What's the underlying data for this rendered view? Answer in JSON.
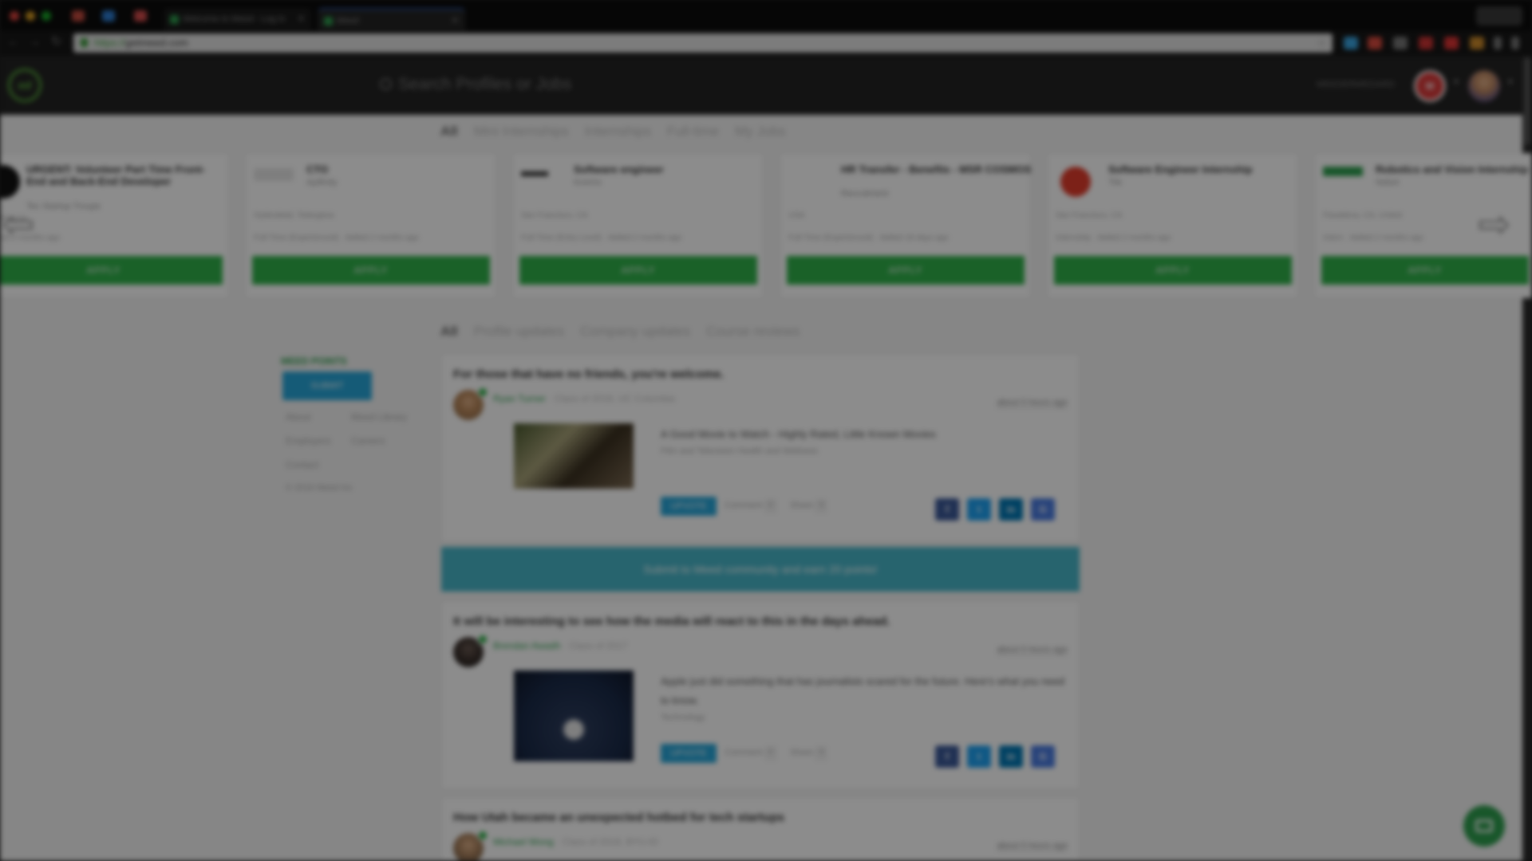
{
  "browser": {
    "tabs": [
      {
        "label": "Welcome to Meed - Log In"
      },
      {
        "label": "Meed"
      }
    ],
    "url_protocol": "https://",
    "url_host": "getmeed.com"
  },
  "header": {
    "logo_text": "mf",
    "search_placeholder": "Search Profiles or Jobs",
    "points_label": "MEEDERMEDARD",
    "badge_label": "M"
  },
  "job_filters": [
    "All",
    "Mini Internships",
    "Internships",
    "Full-time",
    "My Jobs"
  ],
  "jobs": [
    {
      "title": "URGENT: Volunteer Part Time Front-End and Back-End Developer",
      "company": "Tec Startup Troupe",
      "location": "US Remote",
      "meta": "Added 2 months ago",
      "apply": "APPLY",
      "logo_color": "#111111"
    },
    {
      "title": "CTO",
      "company": "Apifinity",
      "location": "Hyderabad, Telangana",
      "meta": "Full-Time (Experienced) · Added 2 months ago",
      "apply": "APPLY",
      "logo_color": "#f4f4f4"
    },
    {
      "title": "Software engineer",
      "company": "Koomo",
      "location": "San Francisco, CA",
      "meta": "Full-Time (Entry Level) · Added 2 months ago",
      "apply": "APPLY",
      "logo_color": "#f4f4f4"
    },
    {
      "title": "HR Transfer - Benefits - MSR COSMOS",
      "company": "Recruitment",
      "location": "USA",
      "meta": "Full-Time (Experienced) · Added 18 days ago",
      "apply": "APPLY",
      "logo_color": "#ffffff"
    },
    {
      "title": "Software Engineer Internship",
      "company": "Tile",
      "location": "San Francisco, CA",
      "meta": "Internship · Added 2 months ago",
      "apply": "APPLY",
      "logo_color": "#e23c2c"
    },
    {
      "title": "Robotics and Vision Internship",
      "company": "Nebot",
      "location": "Pasadena, CA, United",
      "meta": "Intern · Added 2 months ago",
      "apply": "APPLY",
      "logo_color": "#2e9e4e"
    }
  ],
  "feed_filters": [
    "All",
    "Profile updates",
    "Company updates",
    "Course reviews"
  ],
  "sidebar": {
    "points_label": "MEED POINTS",
    "submit_label": "SUBMIT",
    "links": [
      "About",
      "Meed Library",
      "Employers",
      "Careers",
      "Contact"
    ],
    "copyright": "© 2016 Meed Inc"
  },
  "posts": [
    {
      "title": "For those that have no friends, you're welcome.",
      "author": "Ryan Turner",
      "author_sub": "· Class of 2018, UC Columbia",
      "time": "about 5 hours ago",
      "link_title": "A Good Movie to Watch - Highly Rated, Little Known Movies",
      "link_source": "Film and Television Health and Wellness",
      "upvote": "UPVOTE",
      "comments_label": "Comment",
      "comments": "0",
      "shares_label": "Share",
      "shares": "0"
    },
    {
      "title": "It will be interesting to see how the media will react to this in the days ahead.",
      "author": "Brendan Awadh",
      "author_sub": "· Class of 2017",
      "time": "about 5 hours ago",
      "link_title": "Apple just did something that has journalists scared for the future. Here's what you need to know.",
      "link_source": "Technology",
      "upvote": "UPVOTE",
      "comments_label": "Comment",
      "comments": "0",
      "shares_label": "Share",
      "shares": "0"
    },
    {
      "title": "How Utah became an unexpected hotbed for tech startups",
      "author": "Michael Wong",
      "author_sub": "· Class of 2018, BYU-ID",
      "time": "about 5 hours ago"
    }
  ],
  "promo": "Submit to Meed community and earn 20 points!",
  "share_buttons": [
    {
      "icon": "facebook-icon",
      "glyph": "f",
      "color": "#3b5998"
    },
    {
      "icon": "twitter-icon",
      "glyph": "t",
      "color": "#1da1f2"
    },
    {
      "icon": "linkedin-icon",
      "glyph": "in",
      "color": "#0077b5"
    },
    {
      "icon": "google-plus-icon",
      "glyph": "G",
      "color": "#4a7be0"
    }
  ]
}
